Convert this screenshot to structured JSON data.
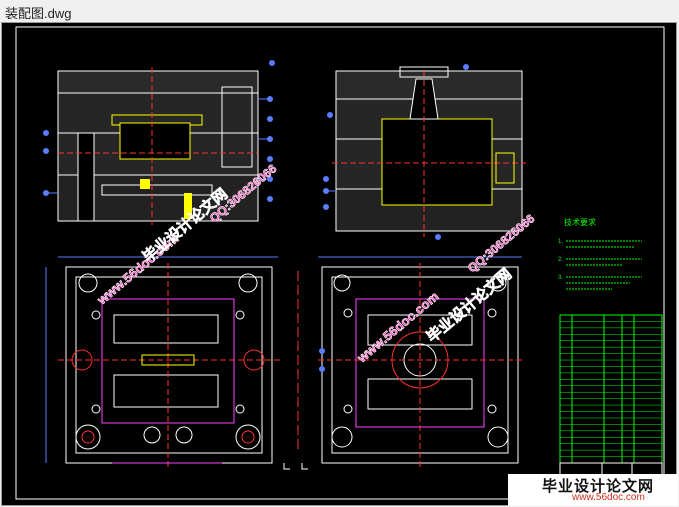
{
  "window": {
    "title": "装配图.dwg"
  },
  "drawing": {
    "background": "#000000",
    "line_color": "#ffffff",
    "accent_colors": {
      "blue": "#5a7cff",
      "yellow": "#ffff00",
      "green": "#00ff00",
      "red": "#ff3030",
      "magenta": "#ff40ff",
      "cyan": "#40ffff"
    },
    "tech_req_title": "技术要求",
    "tech_req_lines": [
      "1.",
      "2.",
      "3."
    ],
    "bom_rows": 23,
    "dims": {
      "left_width": "400",
      "right_width": "400",
      "left_height": "350"
    }
  },
  "watermarks": {
    "site_text": "www.56doc.com",
    "brand_text": "毕业设计论文网",
    "qq_text": "QQ:306826066"
  },
  "corner_stamp": {
    "brand": "毕业设计论文网",
    "url": "www.56doc.com"
  }
}
